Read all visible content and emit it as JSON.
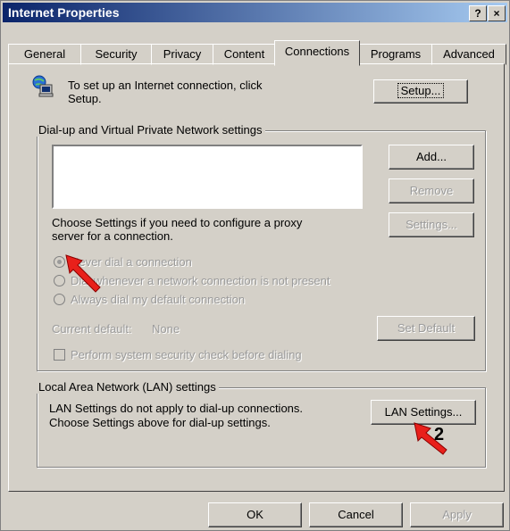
{
  "window": {
    "title": "Internet Properties",
    "help_label": "?",
    "close_label": "×"
  },
  "tabs": [
    "General",
    "Security",
    "Privacy",
    "Content",
    "Connections",
    "Programs",
    "Advanced"
  ],
  "setup": {
    "text_line1": "To set up an Internet connection, click",
    "text_line2": "Setup.",
    "button": "Setup..."
  },
  "dialup": {
    "legend": "Dial-up and Virtual Private Network settings",
    "add": "Add...",
    "remove": "Remove",
    "settings_text_line1": "Choose Settings if you need to configure a proxy",
    "settings_text_line2": "server for a connection.",
    "settings": "Settings...",
    "radio_never": "Never dial a connection",
    "radio_whenever": "Dial whenever a network connection is not present",
    "radio_always": "Always dial my default connection",
    "current_default_label": "Current default:",
    "current_default_value": "None",
    "set_default": "Set Default",
    "security_check": "Perform system security check before dialing"
  },
  "lan": {
    "legend": "Local Area Network (LAN) settings",
    "text_line1": "LAN Settings do not apply to dial-up connections.",
    "text_line2": "Choose Settings above for dial-up settings.",
    "button": "LAN Settings..."
  },
  "footer": {
    "ok": "OK",
    "cancel": "Cancel",
    "apply": "Apply"
  },
  "annotations": {
    "marker2": "2"
  },
  "colors": {
    "title_start": "#0a246a",
    "title_end": "#a6caf0",
    "face": "#d4d0c8",
    "arrow": "#e8201b"
  }
}
